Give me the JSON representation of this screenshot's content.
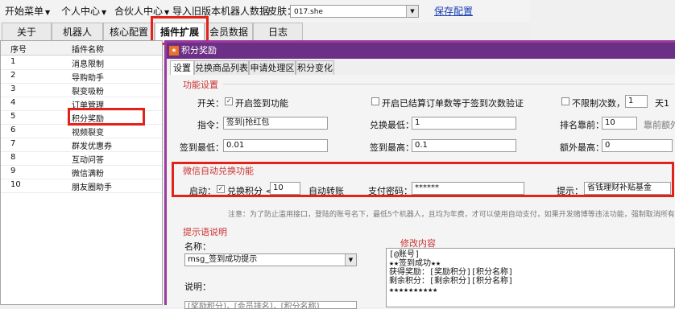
{
  "menubar": {
    "start_menu": "开始菜单",
    "personal_center": "个人中心",
    "partner_center": "合伙人中心",
    "import_old": "导入旧版本机器人数据",
    "skin_label": "皮肤：",
    "skin_value": "017.she",
    "save_config": "保存配置"
  },
  "main_tabs": [
    "关于",
    "机器人",
    "核心配置",
    "插件扩展",
    "会员数据",
    "日志"
  ],
  "plugin_list": {
    "col_index": "序号",
    "col_name": "插件名称",
    "rows": [
      {
        "index": "1",
        "name": "消息限制"
      },
      {
        "index": "2",
        "name": "导购助手"
      },
      {
        "index": "3",
        "name": "裂变吸粉"
      },
      {
        "index": "4",
        "name": "订单管理"
      },
      {
        "index": "5",
        "name": "积分奖励"
      },
      {
        "index": "6",
        "name": "视频裂变"
      },
      {
        "index": "7",
        "name": "群发优惠券"
      },
      {
        "index": "8",
        "name": "互动问答"
      },
      {
        "index": "9",
        "name": "微信满粉"
      },
      {
        "index": "10",
        "name": "朋友圈助手"
      }
    ]
  },
  "dialog": {
    "title": "积分奖励",
    "tabs": [
      "设置",
      "兑换商品列表",
      "申请处理区",
      "积分变化"
    ],
    "function_settings": {
      "section": "功能设置",
      "switch_label": "开关：",
      "signin_checkbox": "开启签到功能",
      "settled_checkbox": "开启已结算订单数等于签到次数验证",
      "unlimited_checkbox": "不限制次数，或",
      "times_value": "1",
      "per_day": "天1",
      "command_label": "指令：",
      "command_value": "签到|抢红包",
      "min_redeem_label": "兑换最低：",
      "min_redeem_value": "1",
      "rank_label": "排名靠前：",
      "rank_value": "10",
      "rank_note": "靠前额外",
      "signin_min_label": "签到最低：",
      "signin_min_value": "0.01",
      "signin_max_label": "签到最高：",
      "signin_max_value": "0.1",
      "extra_max_label": "额外最高：",
      "extra_max_value": "0"
    },
    "auto_redeem": {
      "section": "微信自动兑换功能",
      "enable_label": "启动：",
      "redeem_checkbox": "兑换积分 <=",
      "threshold_value": "10",
      "auto_transfer": "自动转账",
      "pay_password_label": "支付密码：",
      "pay_password_value": "******",
      "hint_label": "提示：",
      "hint_value": "省钱理财补贴基金"
    },
    "notice": "注意：为了防止滥用接口，登陆的账号名下，最低5个机器人，且均为年费，才可以使用自动支付，如果开发赌博等违法功能，强制取消所有授权",
    "prompt": {
      "section": "提示语说明",
      "name_label": "名称：",
      "name_value": "msg_签到成功提示",
      "desc_label": "说明：",
      "desc_value": "[奖励积分]，[会员排名]，[积分名称]",
      "modify_label": "修改内容",
      "content_lines": [
        "[@账号]",
        "★★签到成功★★",
        "获得奖励：[奖励积分][积分名称]",
        "剩余积分：[剩余积分][积分名称]",
        "★★★★★★★★★★"
      ]
    }
  },
  "colors": {
    "accent": "#9b3a9c",
    "highlight": "#e2231a",
    "link": "#1a3fb5"
  }
}
